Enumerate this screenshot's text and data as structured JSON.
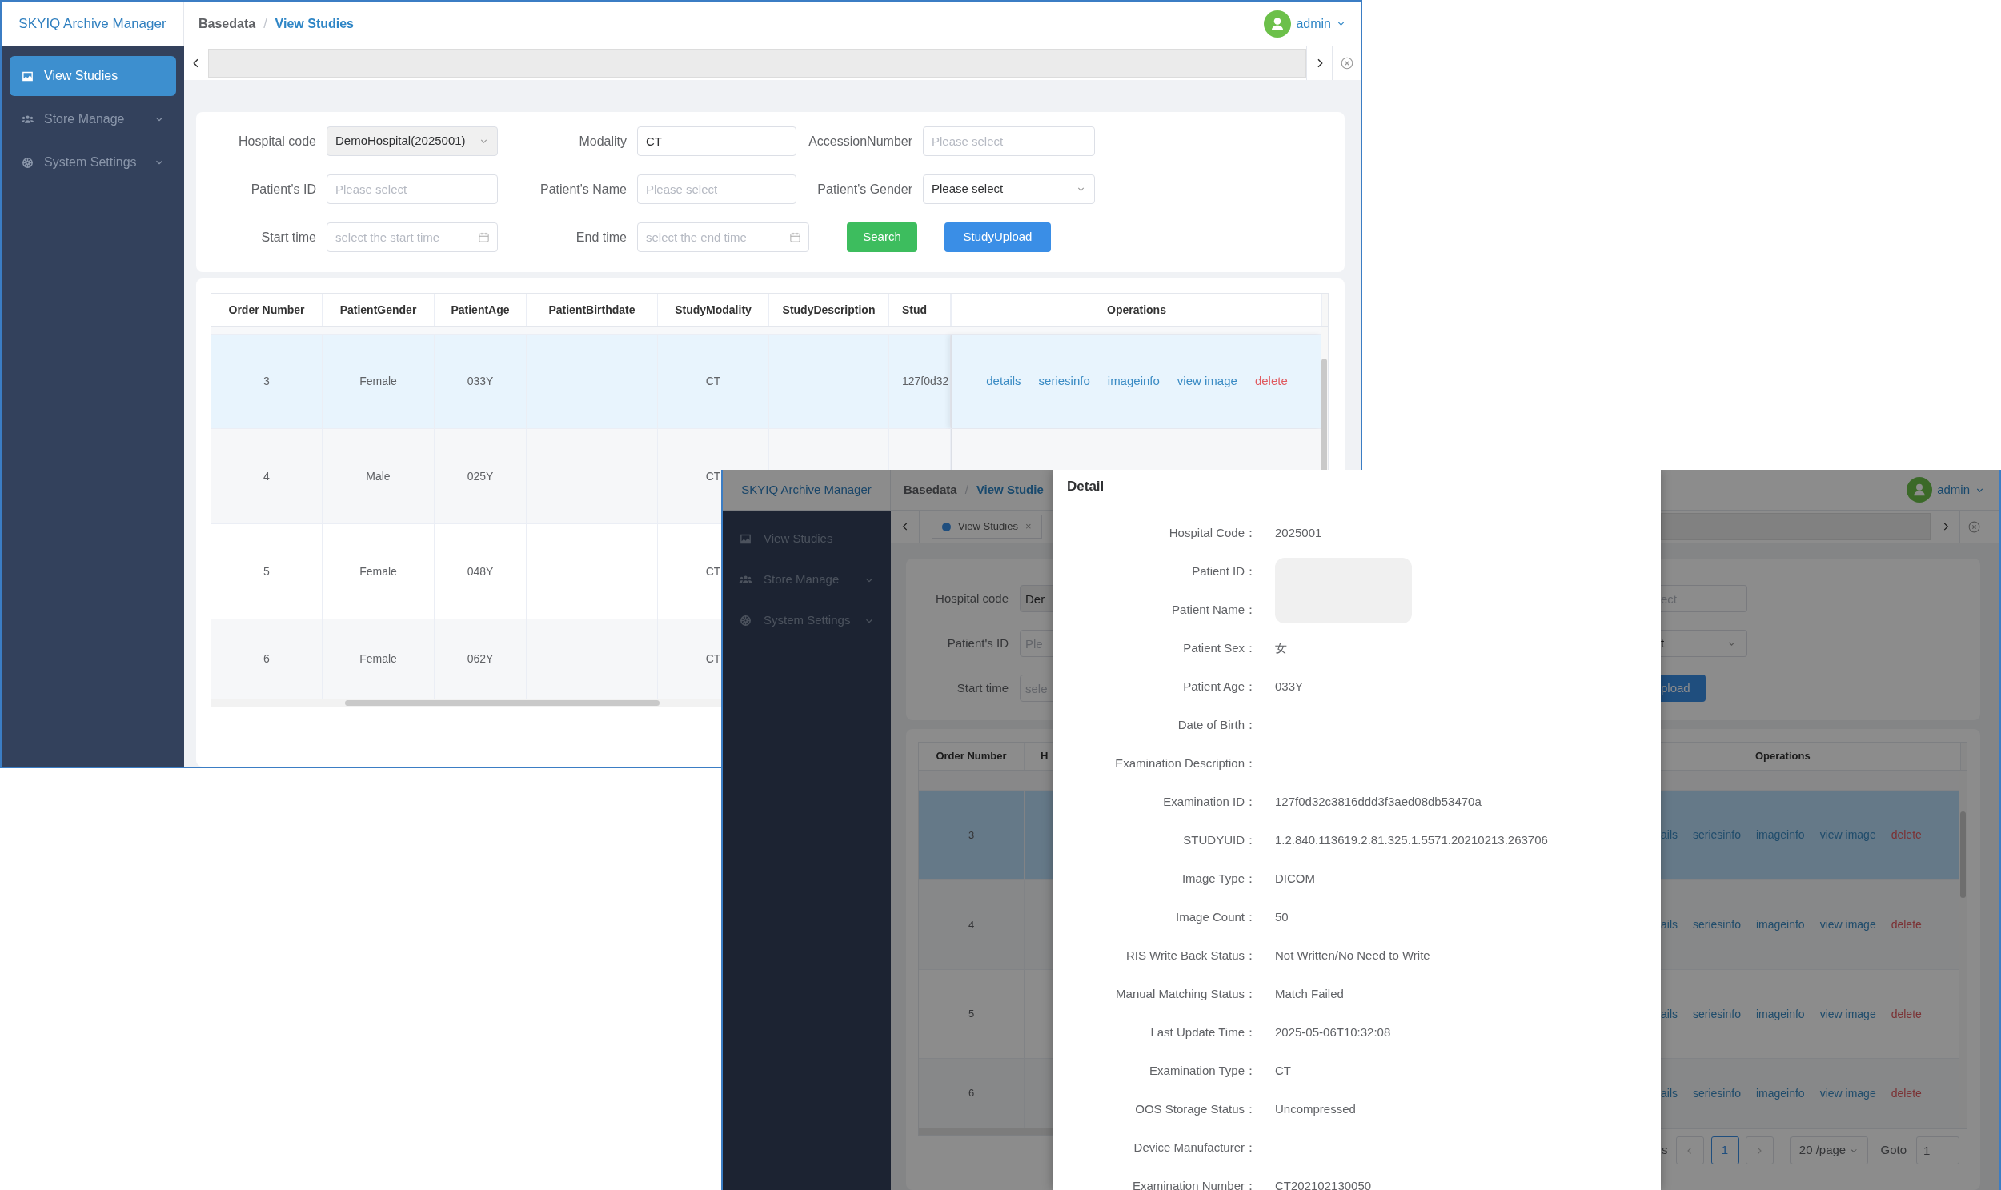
{
  "main_window": {
    "app_title": "SKYIQ Archive Manager",
    "breadcrumb": {
      "items": [
        "Basedata",
        "View Studies"
      ],
      "separator": "/"
    },
    "user": "admin",
    "sidebar": [
      {
        "label": "View Studies",
        "kind": "link",
        "selected": true
      },
      {
        "label": "Store Manage",
        "kind": "submenu",
        "selected": false
      },
      {
        "label": "System Settings",
        "kind": "submenu",
        "selected": false
      }
    ],
    "filters": [
      [
        {
          "label": "Hospital code",
          "kind": "select",
          "value": "DemoHospital(2025001)",
          "disabled": true
        },
        {
          "label": "Modality",
          "kind": "input",
          "value": "CT",
          "disabled": false
        },
        {
          "label": "AccessionNumber",
          "kind": "input",
          "placeholder": "Please select",
          "disabled": false
        }
      ],
      [
        {
          "label": "Patient's ID",
          "kind": "input",
          "placeholder": "Please select",
          "disabled": false
        },
        {
          "label": "Patient's Name",
          "kind": "input",
          "placeholder": "Please select",
          "disabled": false
        },
        {
          "label": "Patient's Gender",
          "kind": "select",
          "value": "Please select",
          "disabled": false
        }
      ],
      [
        {
          "label": "Start time",
          "kind": "date",
          "placeholder": "select the start time",
          "disabled": false
        },
        {
          "label": "End time",
          "kind": "date",
          "placeholder": "select the end time",
          "disabled": false
        }
      ]
    ],
    "buttons": [
      {
        "label": "Search",
        "color": "#3dbd5e"
      },
      {
        "label": "StudyUpload",
        "color": "#3a8ee6"
      }
    ],
    "table": {
      "columns": [
        "Order Number",
        "PatientGender",
        "PatientAge",
        "PatientBirthdate",
        "StudyModality",
        "StudyDescription",
        "Stud",
        "Operations"
      ],
      "rows": [
        {
          "cells": [
            "3",
            "Female",
            "033Y",
            null,
            "CT",
            null,
            "127f0d32"
          ],
          "selected": true,
          "operations": [
            {
              "label": "details",
              "kind": "link"
            },
            {
              "label": "seriesinfo",
              "kind": "link"
            },
            {
              "label": "imageinfo",
              "kind": "link"
            },
            {
              "label": "view image",
              "kind": "link"
            },
            {
              "label": "delete",
              "kind": "danger"
            }
          ]
        },
        {
          "cells": [
            "4",
            "Male",
            "025Y",
            null,
            "CT"
          ],
          "selected": false
        },
        {
          "cells": [
            "5",
            "Female",
            "048Y",
            null,
            "CT"
          ],
          "selected": false
        },
        {
          "cells": [
            "6",
            "Female",
            "062Y",
            null,
            "CT"
          ],
          "selected": false
        }
      ]
    }
  },
  "detail_window": {
    "app_title": "SKYIQ Archive Manager",
    "breadcrumb": {
      "items": [
        "Basedata",
        "View Studie"
      ],
      "separator": "/"
    },
    "user": "admin",
    "sidebar": [
      {
        "label": "View Studies",
        "kind": "link",
        "selected": false
      },
      {
        "label": "Store Manage",
        "kind": "submenu",
        "selected": false
      },
      {
        "label": "System Settings",
        "kind": "submenu",
        "selected": false
      }
    ],
    "tab": {
      "label": "View Studies",
      "close": "×"
    },
    "filters_left": [
      {
        "label": "Hospital code",
        "value": "Der"
      },
      {
        "label": "Patient's ID",
        "placeholder": "Ple"
      },
      {
        "label": "Start time",
        "placeholder": "sele"
      }
    ],
    "filters_right": [
      {
        "kind": "input",
        "placeholder": "ect"
      },
      {
        "kind": "select",
        "value": "t"
      },
      {
        "kind": "button",
        "label": "pload"
      }
    ],
    "table": {
      "columns": [
        "Order Number",
        "H",
        "Operations"
      ],
      "rows": [
        {
          "cells": [
            "3"
          ],
          "selected": true,
          "operations": [
            {
              "label": "ails",
              "kind": "link"
            },
            {
              "label": "seriesinfo",
              "kind": "link"
            },
            {
              "label": "imageinfo",
              "kind": "link"
            },
            {
              "label": "view image",
              "kind": "link"
            },
            {
              "label": "delete",
              "kind": "danger"
            }
          ]
        },
        {
          "cells": [
            "4"
          ],
          "selected": false,
          "operations": [
            {
              "label": "ails",
              "kind": "link"
            },
            {
              "label": "seriesinfo",
              "kind": "link"
            },
            {
              "label": "imageinfo",
              "kind": "link"
            },
            {
              "label": "view image",
              "kind": "link"
            },
            {
              "label": "delete",
              "kind": "danger"
            }
          ]
        },
        {
          "cells": [
            "5"
          ],
          "selected": false,
          "operations": [
            {
              "label": "ails",
              "kind": "link"
            },
            {
              "label": "seriesinfo",
              "kind": "link"
            },
            {
              "label": "imageinfo",
              "kind": "link"
            },
            {
              "label": "view image",
              "kind": "link"
            },
            {
              "label": "delete",
              "kind": "danger"
            }
          ]
        },
        {
          "cells": [
            "6"
          ],
          "selected": false,
          "operations": [
            {
              "label": "ails",
              "kind": "link"
            },
            {
              "label": "seriesinfo",
              "kind": "link"
            },
            {
              "label": "imageinfo",
              "kind": "link"
            },
            {
              "label": "view image",
              "kind": "link"
            },
            {
              "label": "delete",
              "kind": "danger"
            }
          ]
        }
      ]
    },
    "pagination": {
      "total": "s",
      "pages": [
        {
          "label": "1",
          "selected": true
        }
      ],
      "page_size": "20 /page",
      "goto_label": "Goto",
      "goto_value": "1"
    },
    "drawer": {
      "title": "Detail",
      "fields": [
        {
          "label": "Hospital Code：",
          "value": "2025001",
          "redacted": false
        },
        {
          "label": "Patient ID：",
          "redacted": true
        },
        {
          "label": "Patient Name：",
          "redacted": true
        },
        {
          "label": "Patient Sex：",
          "value": "女",
          "redacted": false
        },
        {
          "label": "Patient Age：",
          "value": "033Y",
          "redacted": false
        },
        {
          "label": "Date of Birth：",
          "redacted": false
        },
        {
          "label": "Examination Description：",
          "redacted": false
        },
        {
          "label": "Examination ID：",
          "value": "127f0d32c3816ddd3f3aed08db53470a",
          "redacted": false
        },
        {
          "label": "STUDYUID：",
          "value": "1.2.840.113619.2.81.325.1.5571.20210213.263706",
          "redacted": false
        },
        {
          "label": "Image Type：",
          "value": "DICOM",
          "redacted": false
        },
        {
          "label": "Image Count：",
          "value": "50",
          "redacted": false
        },
        {
          "label": "RIS Write Back Status：",
          "value": "Not Written/No Need to Write",
          "redacted": false
        },
        {
          "label": "Manual Matching Status：",
          "value": "Match Failed",
          "redacted": false
        },
        {
          "label": "Last Update Time：",
          "value": "2025-05-06T10:32:08",
          "redacted": false
        },
        {
          "label": "Examination Type：",
          "value": "CT",
          "redacted": false
        },
        {
          "label": "OOS Storage Status：",
          "value": "Uncompressed",
          "redacted": false
        },
        {
          "label": "Device Manufacturer：",
          "redacted": false
        },
        {
          "label": "Examination Number：",
          "value": "CT202102130050",
          "redacted": false
        }
      ]
    }
  }
}
